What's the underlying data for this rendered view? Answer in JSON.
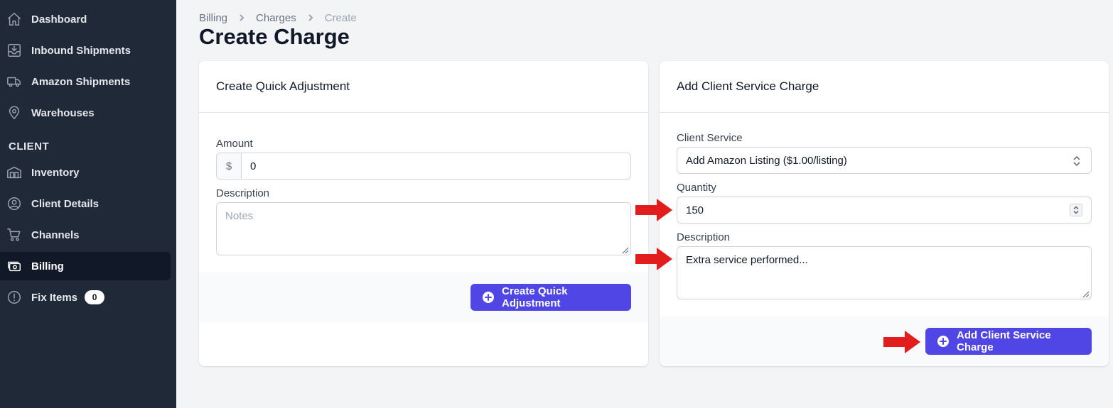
{
  "sidebar": {
    "items": [
      {
        "label": "Dashboard",
        "icon": "home-icon"
      },
      {
        "label": "Inbound Shipments",
        "icon": "inbox-in-icon"
      },
      {
        "label": "Amazon Shipments",
        "icon": "truck-icon"
      },
      {
        "label": "Warehouses",
        "icon": "map-pin-icon"
      }
    ],
    "section_heading": "CLIENT",
    "client_items": [
      {
        "label": "Inventory",
        "icon": "warehouse-icon"
      },
      {
        "label": "Client Details",
        "icon": "user-circle-icon"
      },
      {
        "label": "Channels",
        "icon": "shopping-cart-icon"
      },
      {
        "label": "Billing",
        "icon": "cash-icon",
        "active": true
      },
      {
        "label": "Fix Items",
        "icon": "exclamation-circle-icon",
        "badge": "0"
      }
    ]
  },
  "breadcrumb": [
    "Billing",
    "Charges",
    "Create"
  ],
  "page_title": "Create Charge",
  "quick_adjustment": {
    "title": "Create Quick Adjustment",
    "amount_label": "Amount",
    "currency_prefix": "$",
    "amount_value": "0",
    "description_label": "Description",
    "description_placeholder": "Notes",
    "button_label": "Create Quick Adjustment"
  },
  "client_service_charge": {
    "title": "Add Client Service Charge",
    "service_label": "Client Service",
    "service_value": "Add Amazon Listing ($1.00/listing)",
    "quantity_label": "Quantity",
    "quantity_value": "150",
    "description_label": "Description",
    "description_value": "Extra service performed...",
    "button_label": "Add Client Service Charge"
  },
  "colors": {
    "sidebar_bg": "#1f2937",
    "active_item_bg": "#111827",
    "primary_button": "#4f46e5",
    "annotation_arrow": "#e11d1d"
  }
}
